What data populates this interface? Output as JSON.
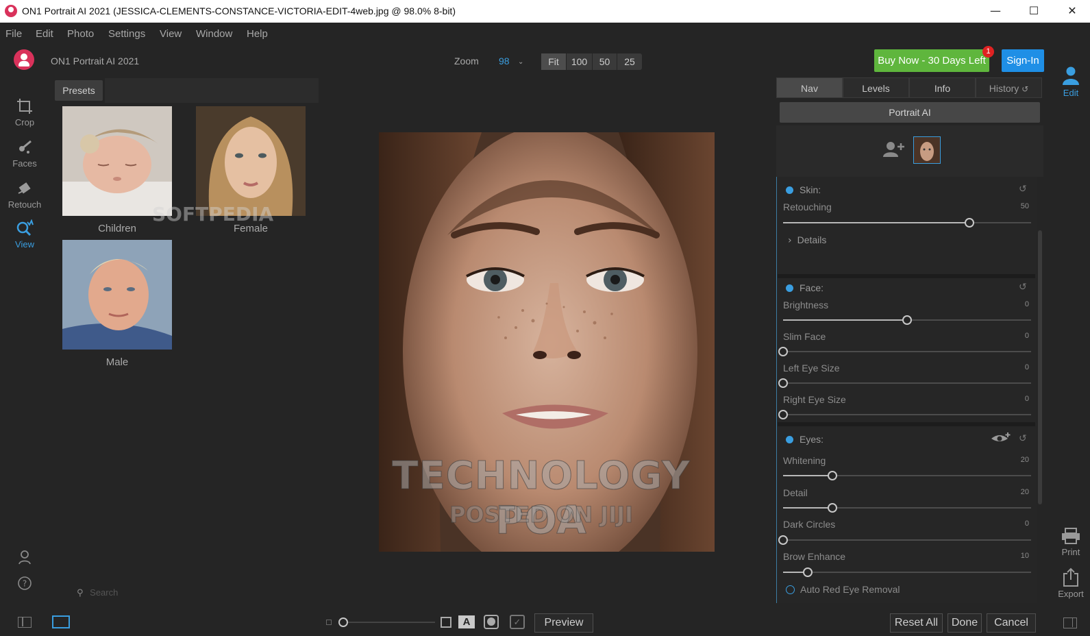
{
  "window": {
    "title": "ON1 Portrait AI 2021 (JESSICA-CLEMENTS-CONSTANCE-VICTORIA-EDIT-4web.jpg @ 98.0% 8-bit)",
    "controls": [
      "minimize-icon",
      "maximize-icon",
      "close-icon"
    ]
  },
  "menu": [
    "File",
    "Edit",
    "Photo",
    "Settings",
    "View",
    "Window",
    "Help"
  ],
  "toolbar": {
    "app_name": "ON1 Portrait AI 2021",
    "zoom_label": "Zoom",
    "zoom_value": "98",
    "zoom_presets": [
      "Fit",
      "100",
      "50",
      "25"
    ],
    "buy_label": "Buy Now - 30 Days Left",
    "buy_badge": "1",
    "signin_label": "Sign-In"
  },
  "left_tools": [
    {
      "label": "Crop",
      "icon": "crop-icon"
    },
    {
      "label": "Faces",
      "icon": "faces-icon"
    },
    {
      "label": "Retouch",
      "icon": "retouch-icon"
    },
    {
      "label": "View",
      "icon": "view-icon",
      "active": true
    }
  ],
  "presets": {
    "tab_label": "Presets",
    "items": [
      "Children",
      "Female",
      "Male"
    ],
    "search_placeholder": "Search"
  },
  "watermarks": {
    "softpedia": "SOFTPEDIA",
    "line1": "TECHNOLOGY POA",
    "line2": "POSTED ON JIJI"
  },
  "right_panel": {
    "tabs": [
      "Nav",
      "Levels",
      "Info",
      "History"
    ],
    "portrait_label": "Portrait AI",
    "skin": {
      "title": "Skin:",
      "sliders": [
        {
          "label": "Retouching",
          "value": 50
        }
      ],
      "details_label": "Details"
    },
    "face": {
      "title": "Face:",
      "sliders": [
        {
          "label": "Brightness",
          "value": 0
        },
        {
          "label": "Slim Face",
          "value": 0
        },
        {
          "label": "Left Eye Size",
          "value": 0
        },
        {
          "label": "Right Eye Size",
          "value": 0
        }
      ]
    },
    "eyes": {
      "title": "Eyes:",
      "sliders": [
        {
          "label": "Whitening",
          "value": 20
        },
        {
          "label": "Detail",
          "value": 20
        },
        {
          "label": "Dark Circles",
          "value": 0
        },
        {
          "label": "Brow Enhance",
          "value": 10
        }
      ],
      "red_eye_label": "Auto Red Eye Removal"
    }
  },
  "right_tools": [
    {
      "label": "Edit",
      "icon": "edit-person-icon",
      "active": true
    },
    {
      "label": "Print",
      "icon": "print-icon"
    },
    {
      "label": "Export",
      "icon": "export-icon"
    }
  ],
  "bottom": {
    "preview_label": "Preview",
    "reset_all_label": "Reset All",
    "done_label": "Done",
    "cancel_label": "Cancel"
  },
  "colors": {
    "accent": "#3a9ee0",
    "buy": "#5fb63d",
    "signin": "#1f8fe6",
    "brand": "#d9325b"
  }
}
